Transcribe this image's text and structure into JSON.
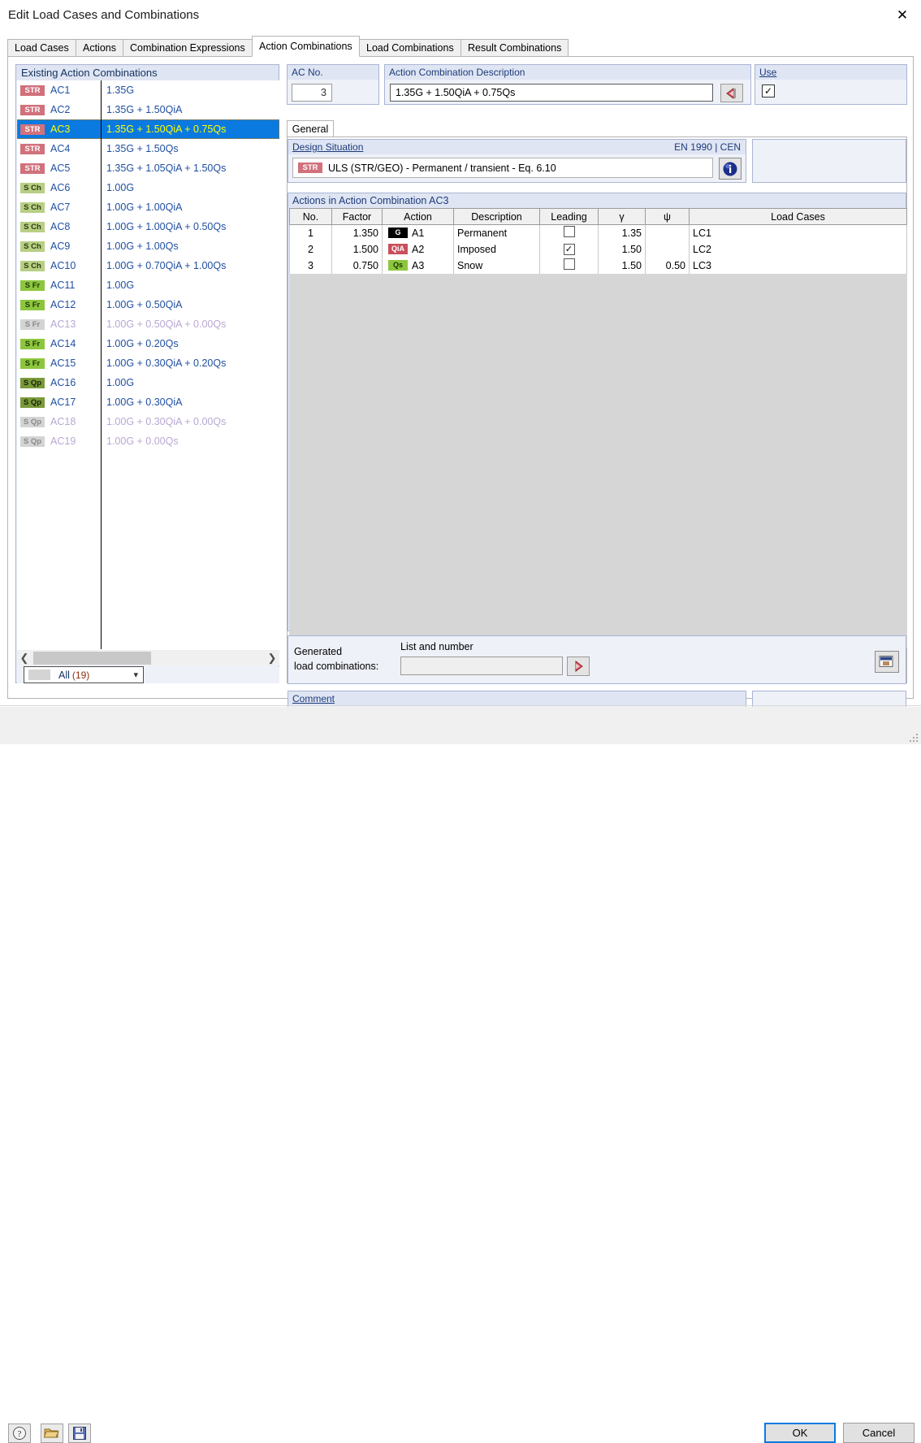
{
  "window": {
    "title": "Edit Load Cases and Combinations",
    "close_icon": "close-icon"
  },
  "tabs": [
    {
      "label": "Load Cases",
      "active": false
    },
    {
      "label": "Actions",
      "active": false
    },
    {
      "label": "Combination Expressions",
      "active": false
    },
    {
      "label": "Action Combinations",
      "active": true
    },
    {
      "label": "Load Combinations",
      "active": false
    },
    {
      "label": "Result Combinations",
      "active": false
    }
  ],
  "left_panel": {
    "header": "Existing Action Combinations",
    "rows": [
      {
        "badge": "STR",
        "badge_kind": "str",
        "name": "AC1",
        "expr": "1.35G",
        "selected": false,
        "disabled": false
      },
      {
        "badge": "STR",
        "badge_kind": "str",
        "name": "AC2",
        "expr": "1.35G + 1.50QiA",
        "selected": false,
        "disabled": false
      },
      {
        "badge": "STR",
        "badge_kind": "str",
        "name": "AC3",
        "expr": "1.35G + 1.50QiA + 0.75Qs",
        "selected": true,
        "disabled": false
      },
      {
        "badge": "STR",
        "badge_kind": "str",
        "name": "AC4",
        "expr": "1.35G + 1.50Qs",
        "selected": false,
        "disabled": false
      },
      {
        "badge": "STR",
        "badge_kind": "str",
        "name": "AC5",
        "expr": "1.35G + 1.05QiA + 1.50Qs",
        "selected": false,
        "disabled": false
      },
      {
        "badge": "S Ch",
        "badge_kind": "sch",
        "name": "AC6",
        "expr": "1.00G",
        "selected": false,
        "disabled": false
      },
      {
        "badge": "S Ch",
        "badge_kind": "sch",
        "name": "AC7",
        "expr": "1.00G + 1.00QiA",
        "selected": false,
        "disabled": false
      },
      {
        "badge": "S Ch",
        "badge_kind": "sch",
        "name": "AC8",
        "expr": "1.00G + 1.00QiA + 0.50Qs",
        "selected": false,
        "disabled": false
      },
      {
        "badge": "S Ch",
        "badge_kind": "sch",
        "name": "AC9",
        "expr": "1.00G + 1.00Qs",
        "selected": false,
        "disabled": false
      },
      {
        "badge": "S Ch",
        "badge_kind": "sch",
        "name": "AC10",
        "expr": "1.00G + 0.70QiA + 1.00Qs",
        "selected": false,
        "disabled": false
      },
      {
        "badge": "S Fr",
        "badge_kind": "sfr",
        "name": "AC11",
        "expr": "1.00G",
        "selected": false,
        "disabled": false
      },
      {
        "badge": "S Fr",
        "badge_kind": "sfr",
        "name": "AC12",
        "expr": "1.00G + 0.50QiA",
        "selected": false,
        "disabled": false
      },
      {
        "badge": "S Fr",
        "badge_kind": "dis",
        "name": "AC13",
        "expr": "1.00G + 0.50QiA + 0.00Qs",
        "selected": false,
        "disabled": true
      },
      {
        "badge": "S Fr",
        "badge_kind": "sfr",
        "name": "AC14",
        "expr": "1.00G + 0.20Qs",
        "selected": false,
        "disabled": false
      },
      {
        "badge": "S Fr",
        "badge_kind": "sfr",
        "name": "AC15",
        "expr": "1.00G + 0.30QiA + 0.20Qs",
        "selected": false,
        "disabled": false
      },
      {
        "badge": "S Qp",
        "badge_kind": "sqp",
        "name": "AC16",
        "expr": "1.00G",
        "selected": false,
        "disabled": false
      },
      {
        "badge": "S Qp",
        "badge_kind": "sqp",
        "name": "AC17",
        "expr": "1.00G + 0.30QiA",
        "selected": false,
        "disabled": false
      },
      {
        "badge": "S Qp",
        "badge_kind": "dis",
        "name": "AC18",
        "expr": "1.00G + 0.30QiA + 0.00Qs",
        "selected": false,
        "disabled": true
      },
      {
        "badge": "S Qp",
        "badge_kind": "dis",
        "name": "AC19",
        "expr": "1.00G + 0.00Qs",
        "selected": false,
        "disabled": true
      }
    ],
    "scroll_left_icon": "chevron-left-icon",
    "scroll_right_icon": "chevron-right-icon",
    "filter": {
      "label": "All",
      "count": "(19)",
      "arrow_icon": "chevron-down-icon"
    }
  },
  "ac_no": {
    "header": "AC No.",
    "value": "3"
  },
  "description": {
    "header": "Action Combination Description",
    "value": "1.35G + 1.50QiA + 0.75Qs",
    "button_icon": "back-arrow-icon"
  },
  "use": {
    "header": "Use",
    "checked": true,
    "check_glyph": "✓"
  },
  "general_tab": {
    "label": "General"
  },
  "design_situation": {
    "header": "Design Situation",
    "standard": "EN 1990 | CEN",
    "badge": "STR",
    "value": "ULS (STR/GEO) - Permanent / transient - Eq. 6.10",
    "info_icon": "info-icon"
  },
  "actions_table": {
    "header": "Actions in Action Combination AC3",
    "columns": [
      "No.",
      "Factor",
      "Action",
      "Description",
      "Leading",
      "γ",
      "ψ",
      "Load Cases"
    ],
    "rows": [
      {
        "no": "1",
        "factor": "1.350",
        "action_badge": "G",
        "action_kind": "g",
        "action": "A1",
        "description": "Permanent",
        "leading": false,
        "gamma": "1.35",
        "psi": "",
        "load_cases": "LC1"
      },
      {
        "no": "2",
        "factor": "1.500",
        "action_badge": "QiA",
        "action_kind": "qia",
        "action": "A2",
        "description": "Imposed",
        "leading": true,
        "gamma": "1.50",
        "psi": "",
        "load_cases": "LC2"
      },
      {
        "no": "3",
        "factor": "0.750",
        "action_badge": "Qs",
        "action_kind": "qs",
        "action": "A3",
        "description": "Snow",
        "leading": false,
        "gamma": "1.50",
        "psi": "0.50",
        "load_cases": "LC3"
      }
    ],
    "check_glyph": "✓"
  },
  "generated": {
    "label_line1": "Generated",
    "label_line2": "load combinations:",
    "field_label": "List and number",
    "value": "",
    "run_icon": "right-arrow-icon",
    "table_icon": "table-view-icon"
  },
  "comment": {
    "header": "Comment",
    "value": "",
    "dropdown_icon": "chevron-down-icon",
    "button_icon": "copy-icon"
  },
  "footer": {
    "help_icon": "help-icon",
    "open_icon": "open-folder-icon",
    "save_icon": "save-icon",
    "ok_label": "OK",
    "cancel_label": "Cancel"
  }
}
